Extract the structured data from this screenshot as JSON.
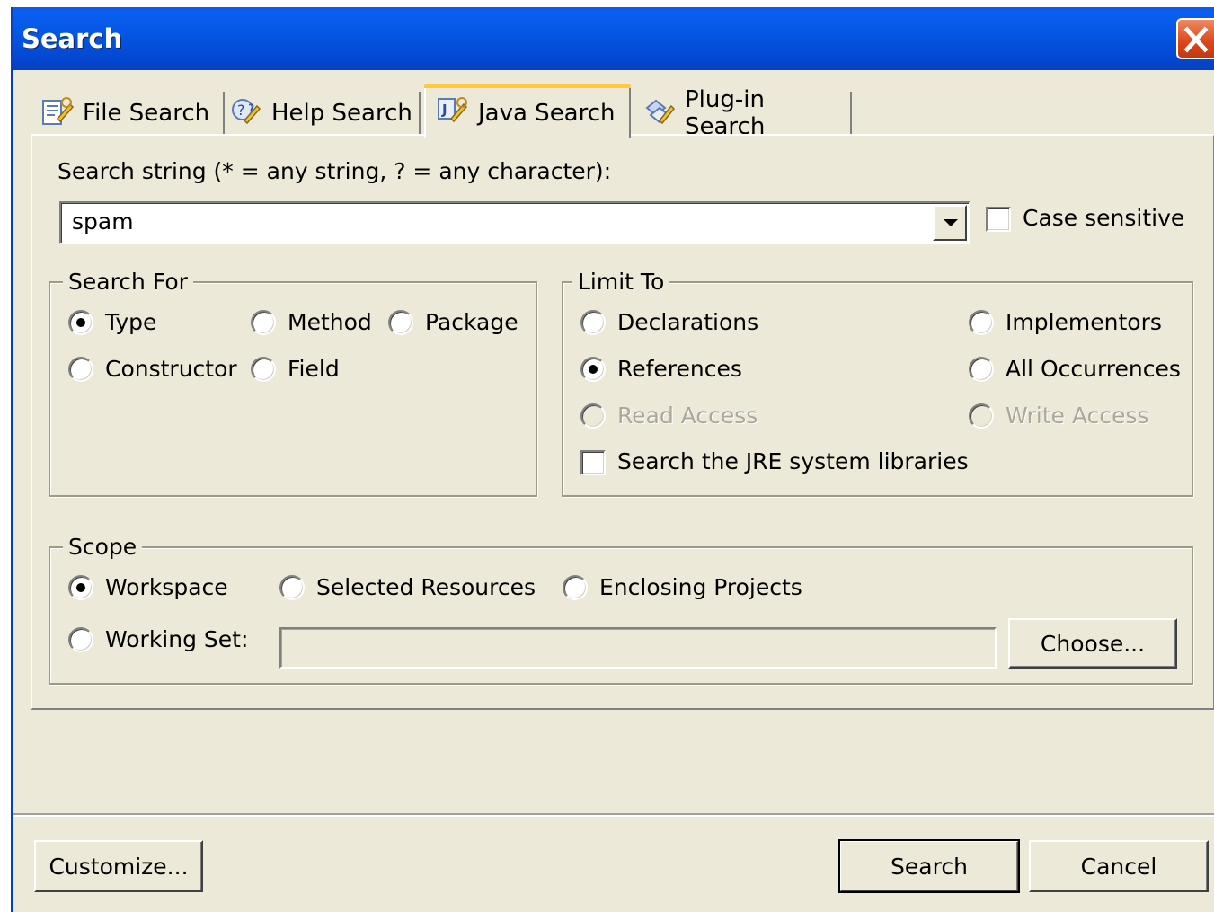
{
  "window": {
    "title": "Search"
  },
  "tabs": [
    {
      "label": "File Search",
      "icon": "file-search-icon",
      "selected": false
    },
    {
      "label": "Help Search",
      "icon": "help-search-icon",
      "selected": false
    },
    {
      "label": "Java Search",
      "icon": "java-search-icon",
      "selected": true
    },
    {
      "label": "Plug-in Search",
      "icon": "plugin-search-icon",
      "selected": false
    }
  ],
  "search_string": {
    "label": "Search string (* = any string, ? = any character):",
    "value": "spam",
    "case_sensitive_label": "Case sensitive",
    "case_sensitive_checked": false
  },
  "search_for": {
    "title": "Search For",
    "options": [
      "Type",
      "Method",
      "Package",
      "Constructor",
      "Field"
    ],
    "selected": "Type"
  },
  "limit_to": {
    "title": "Limit To",
    "options": [
      "Declarations",
      "Implementors",
      "References",
      "All Occurrences",
      "Read Access",
      "Write Access"
    ],
    "selected": "References",
    "disabled": [
      "Read Access",
      "Write Access"
    ],
    "jre_label": "Search the JRE system libraries",
    "jre_checked": false
  },
  "scope": {
    "title": "Scope",
    "options": [
      "Workspace",
      "Selected Resources",
      "Enclosing Projects",
      "Working Set:"
    ],
    "selected": "Workspace",
    "working_set_value": "",
    "choose_label": "Choose..."
  },
  "buttons": {
    "customize": "Customize...",
    "search": "Search",
    "cancel": "Cancel"
  },
  "colors": {
    "titlebar": "#0454e0",
    "dialog_bg": "#ece9d8",
    "selected_tab_accent": "#ffc83d"
  }
}
